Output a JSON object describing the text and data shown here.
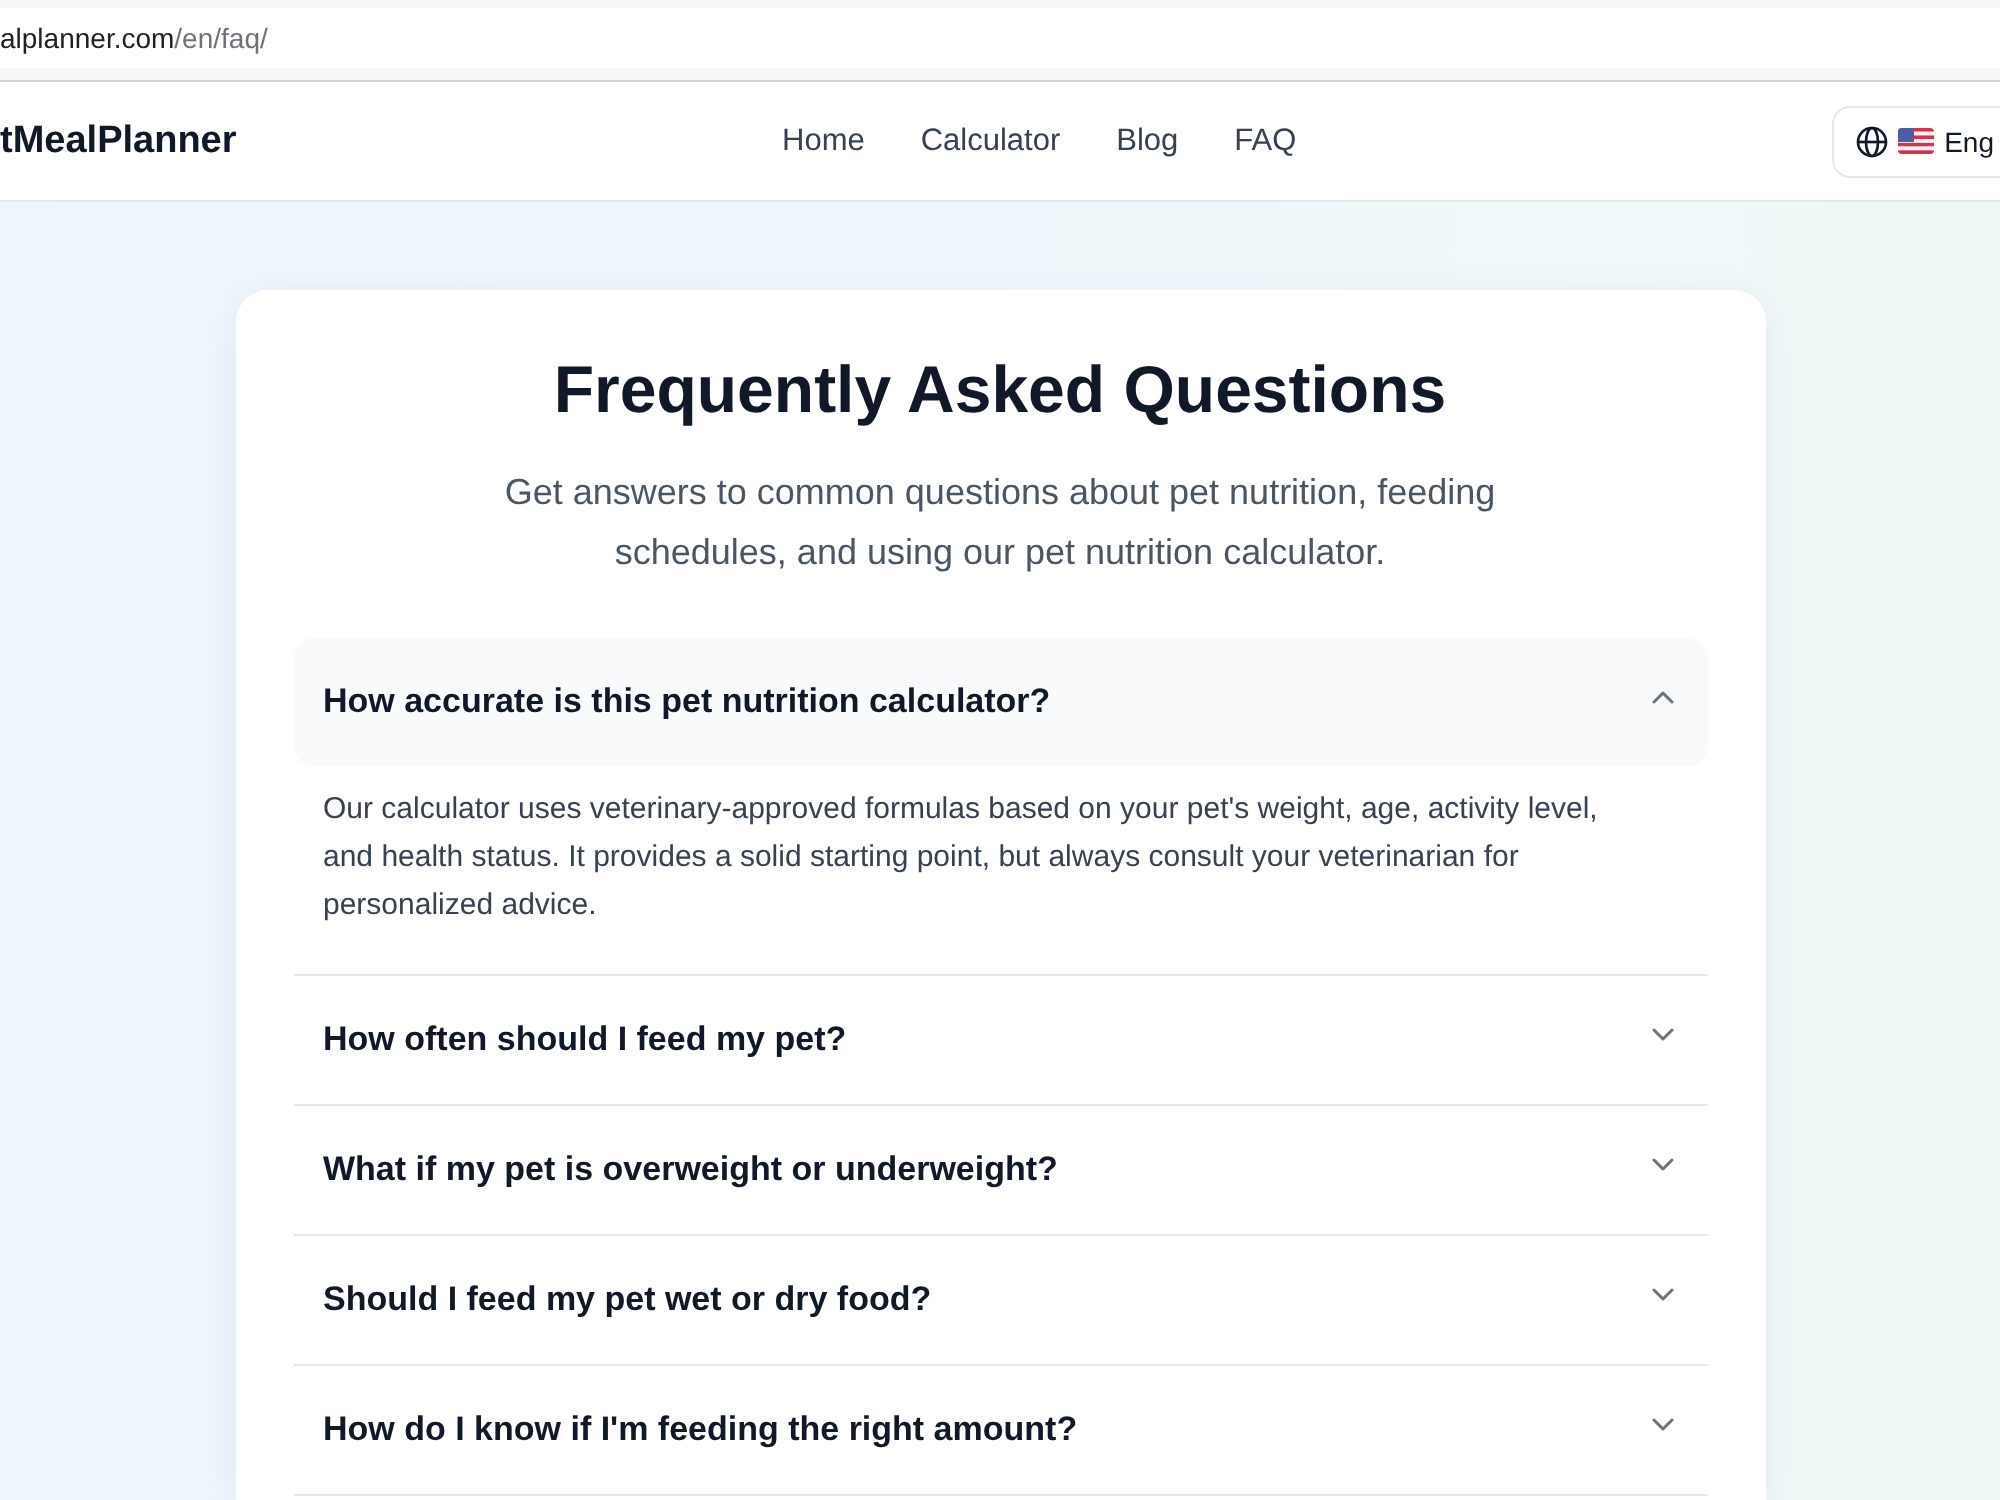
{
  "browser": {
    "url_host": "alplanner.com",
    "url_path": "/en/faq/"
  },
  "header": {
    "logo": "tMealPlanner",
    "nav": [
      "Home",
      "Calculator",
      "Blog",
      "FAQ"
    ],
    "language": "Eng"
  },
  "faq": {
    "title": "Frequently Asked Questions",
    "subtitle": "Get answers to common questions about pet nutrition, feeding schedules, and using our pet nutrition calculator.",
    "items": [
      {
        "question": "How accurate is this pet nutrition calculator?",
        "answer": "Our calculator uses veterinary-approved formulas based on your pet's weight, age, activity level, and health status. It provides a solid starting point, but always consult your veterinarian for personalized advice.",
        "expanded": true
      },
      {
        "question": "How often should I feed my pet?",
        "expanded": false
      },
      {
        "question": "What if my pet is overweight or underweight?",
        "expanded": false
      },
      {
        "question": "Should I feed my pet wet or dry food?",
        "expanded": false
      },
      {
        "question": "How do I know if I'm feeding the right amount?",
        "expanded": false
      }
    ]
  }
}
